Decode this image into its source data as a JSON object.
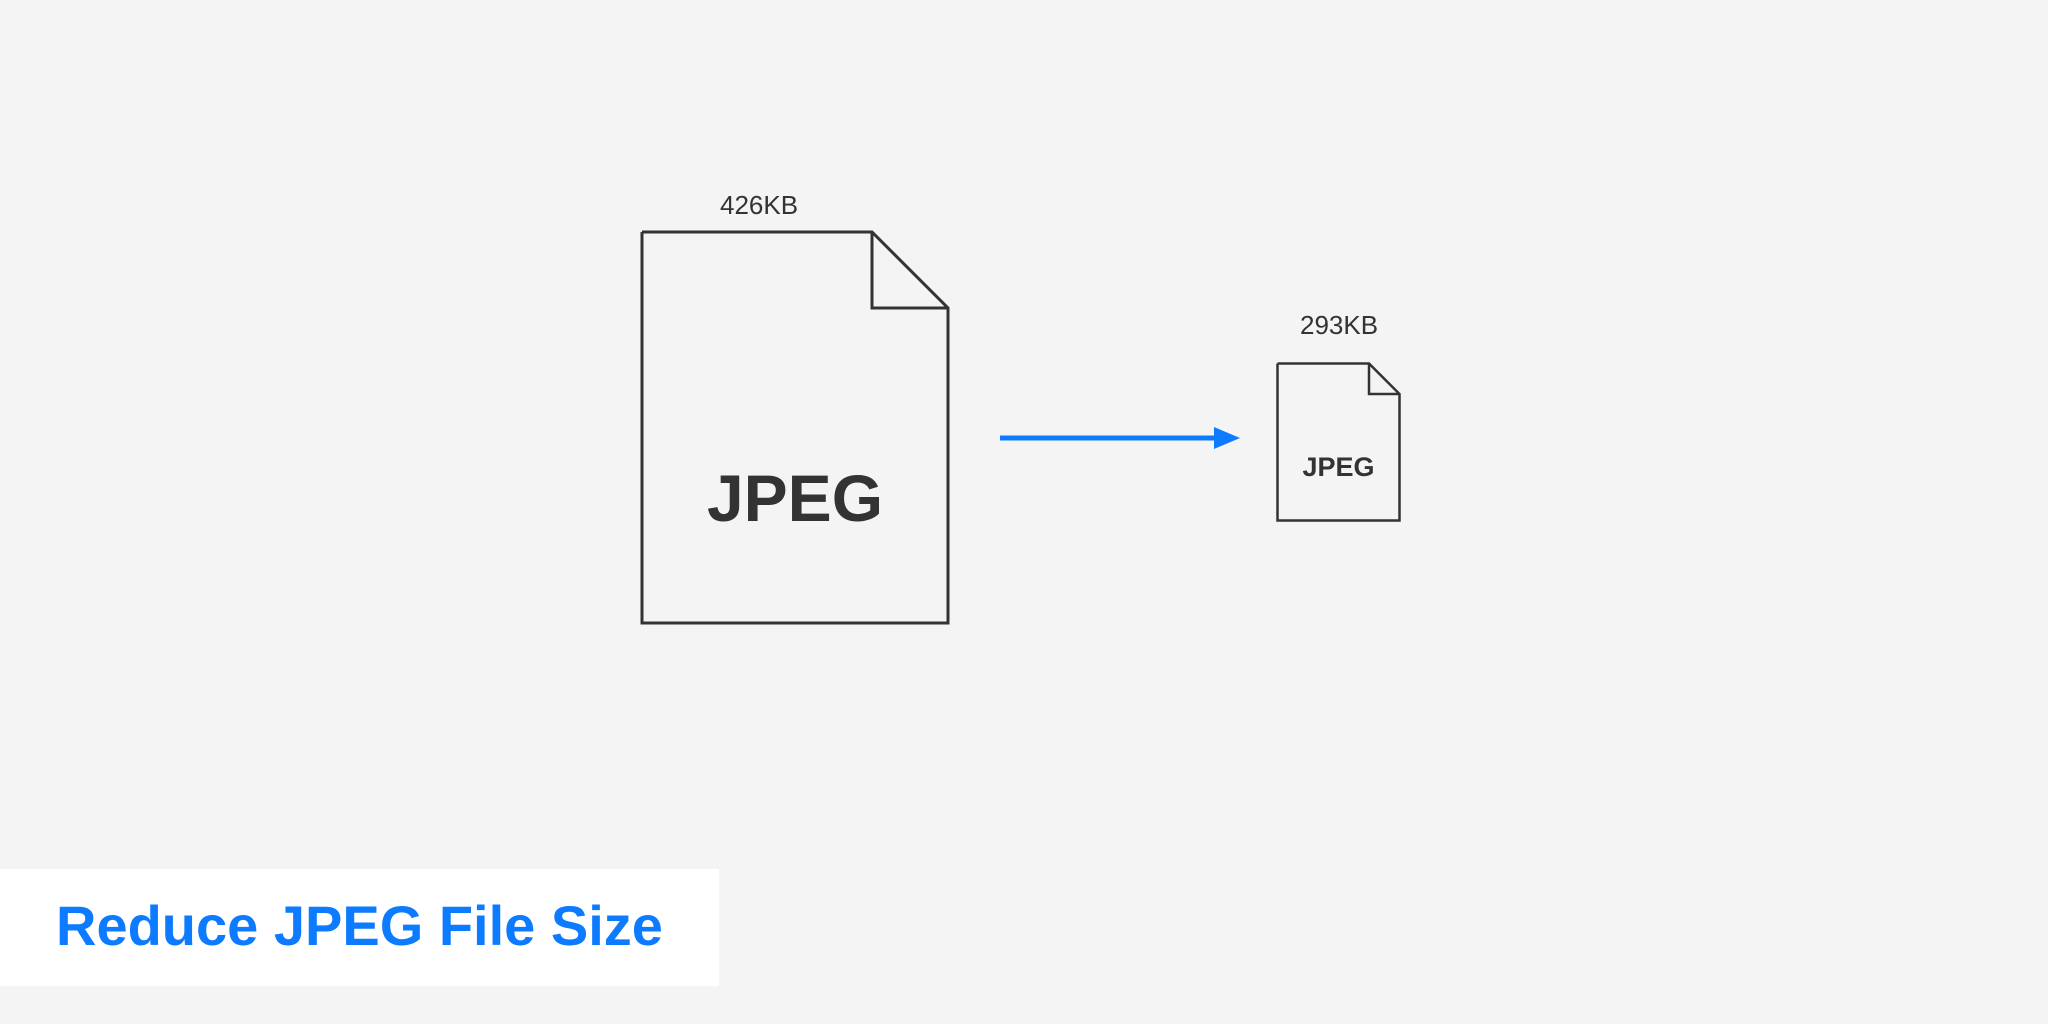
{
  "diagram": {
    "source_file": {
      "format_label": "JPEG",
      "size_label": "426KB"
    },
    "target_file": {
      "format_label": "JPEG",
      "size_label": "293KB"
    }
  },
  "title": "Reduce JPEG File Size",
  "colors": {
    "accent": "#0d7bff",
    "stroke": "#333333",
    "bg": "#f4f4f4"
  }
}
